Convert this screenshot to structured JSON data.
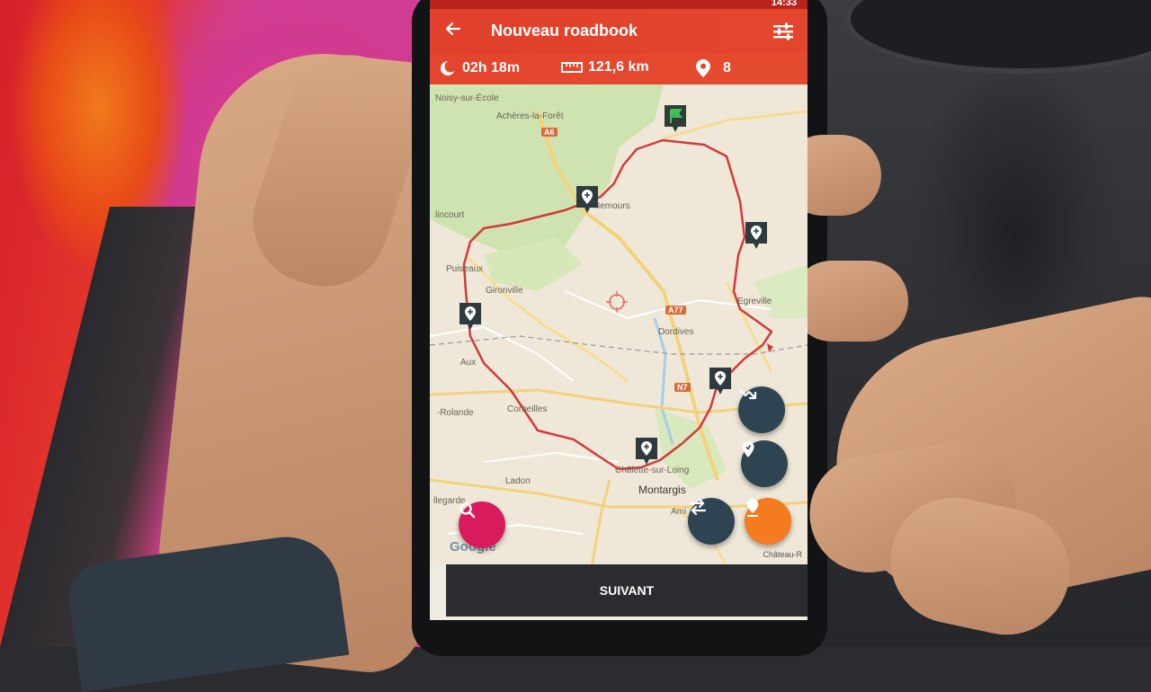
{
  "status_bar": {
    "time": "14:33"
  },
  "app_bar": {
    "title": "Nouveau roadbook"
  },
  "stats": {
    "duration": "02h 18m",
    "distance": "121,6 km",
    "waypoints": "8"
  },
  "map": {
    "labels": {
      "noisy": "Noisy-sur-École",
      "acheres": "Achères-la-Forêt",
      "nemours": "Nemours",
      "puiseaux": "Puiseaux",
      "gironville": "Gironville",
      "egreville": "Egreville",
      "dordives": "Dordives",
      "aux": "Aux",
      "rolande": "-Rolande",
      "corbeilles": "Corbeilles",
      "chatillon": "Châlette-sur-Loing",
      "montargis": "Montargis",
      "ladon": "Ladon",
      "bellegarde": "llegarde",
      "amilly": "Ami",
      "malesherbes": "lincourt",
      "chateau": "Château-R"
    },
    "shields": {
      "a6": "A6",
      "a77": "A77",
      "n7": "N7"
    },
    "attribution": "Google"
  },
  "fabs": {
    "route_icon": "route-arrow-icon",
    "waypoint_icon": "map-marker-icon",
    "swap_icon": "swap-arrows-icon",
    "add_pin_icon": "add-pin-icon",
    "search_icon": "search-icon"
  },
  "bottom_bar": {
    "next_label": "SUIVANT"
  },
  "colors": {
    "primary": "#e0402c",
    "route": "#d23a3a",
    "fab_dark": "#2f4452",
    "fab_orange": "#f47b1f",
    "fab_magenta": "#d81b5c",
    "bottom_bar": "#2a2c30"
  }
}
